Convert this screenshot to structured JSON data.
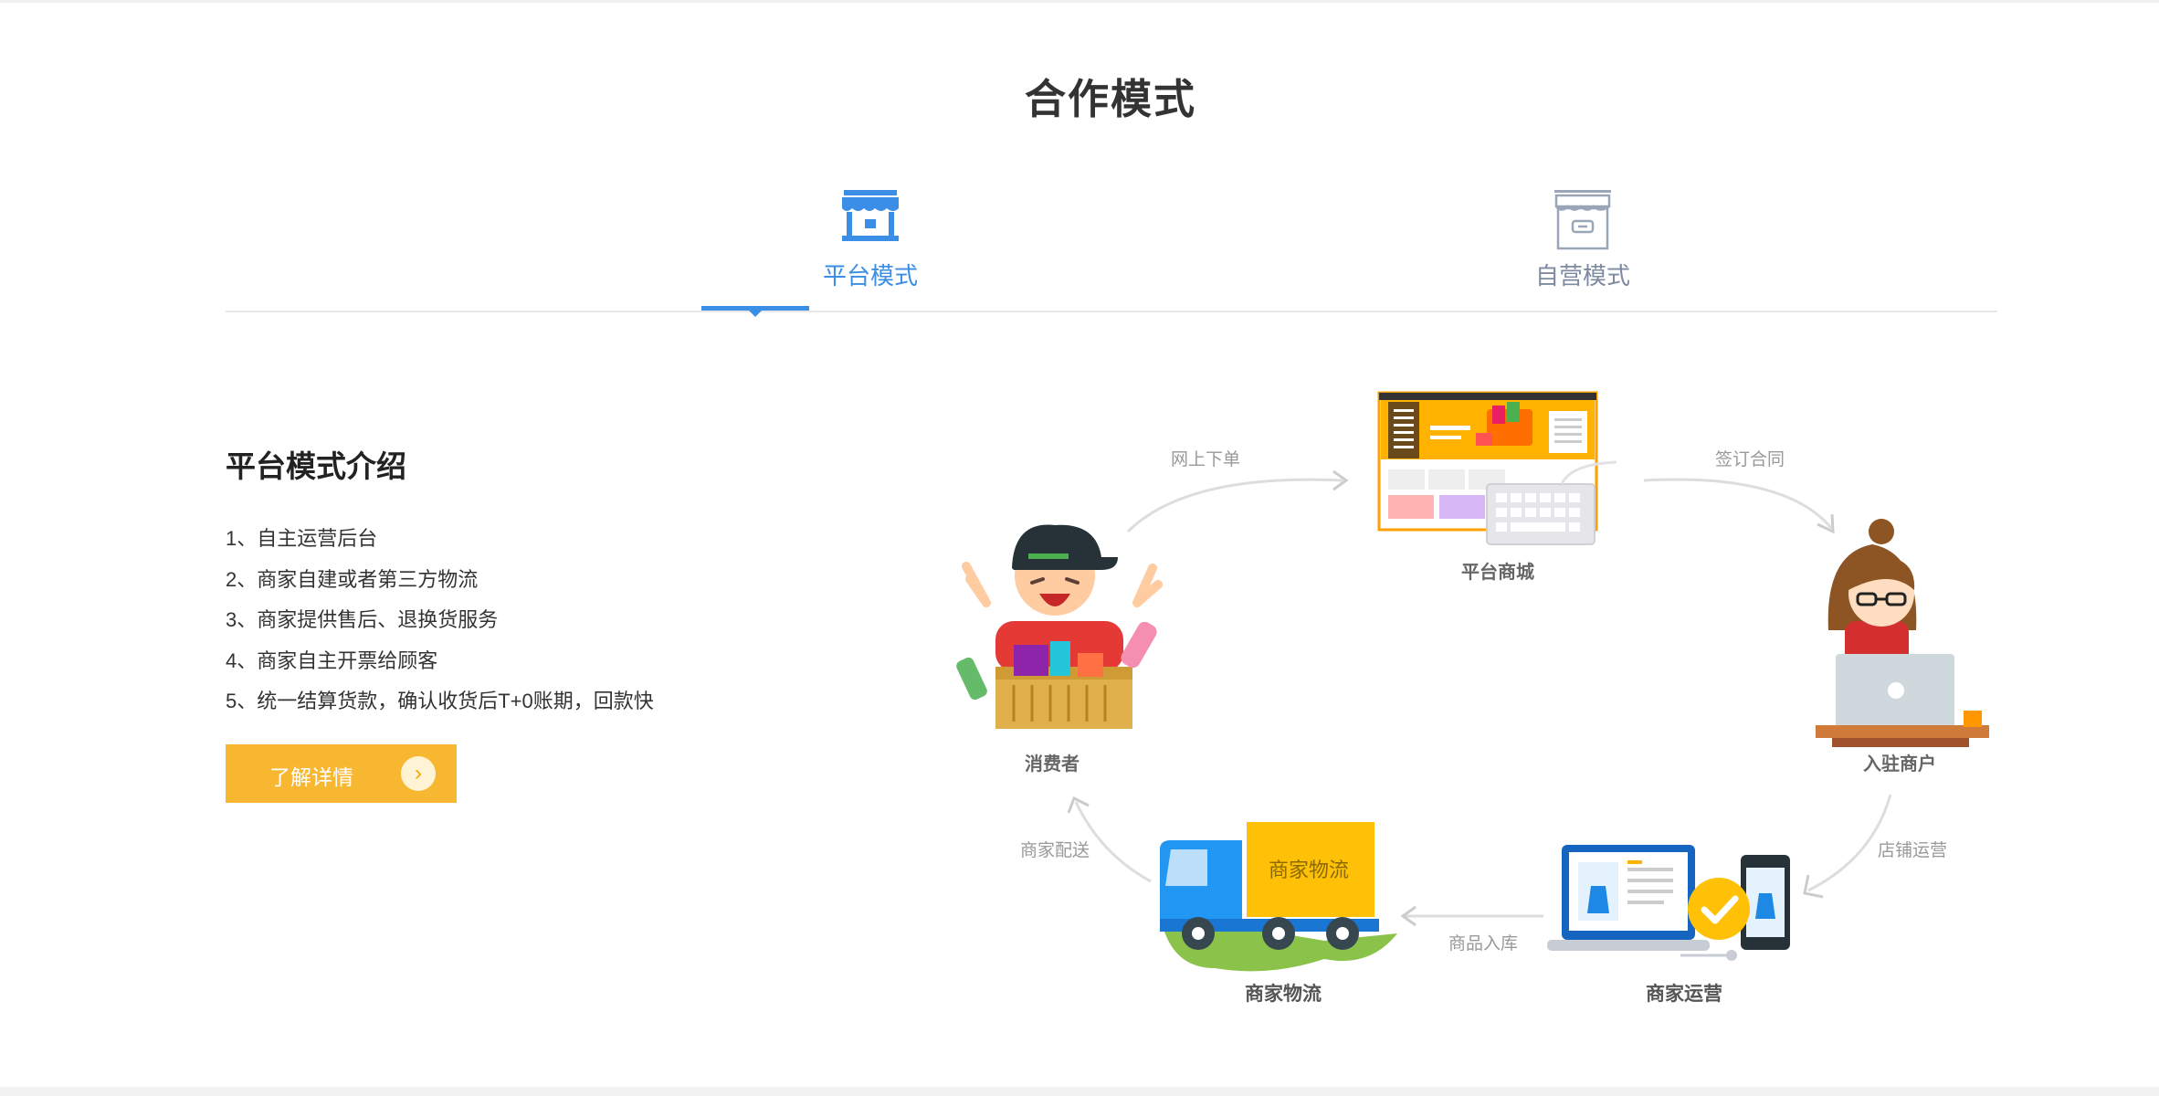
{
  "section": {
    "title": "合作模式"
  },
  "tabs": [
    {
      "label": "平台模式",
      "icon": "store-icon",
      "active": true
    },
    {
      "label": "自营模式",
      "icon": "shop-box-icon",
      "active": false
    }
  ],
  "intro": {
    "title": "平台模式介绍",
    "items": [
      "1、自主运营后台",
      "2、商家自建或者第三方物流",
      "3、商家提供售后、退换货服务",
      "4、商家自主开票给顾客",
      "5、统一结算货款，确认收货后T+0账期，回款快"
    ],
    "button_label": "了解详情",
    "button_icon": "chevron-right-icon"
  },
  "diagram": {
    "nodes": {
      "mall": "平台商城",
      "consumer": "消费者",
      "merchant": "入驻商户",
      "logistics": "商家物流",
      "operation": "商家运营",
      "truck_text": "商家物流"
    },
    "flows": {
      "order": "网上下单",
      "contract": "签订合同",
      "delivery": "商家配送",
      "store_ops": "店铺运营",
      "warehousing": "商品入库"
    }
  },
  "colors": {
    "accent_blue": "#3a8ee6",
    "button_yellow": "#f7b731",
    "tab_inactive": "#7d8aa0"
  }
}
